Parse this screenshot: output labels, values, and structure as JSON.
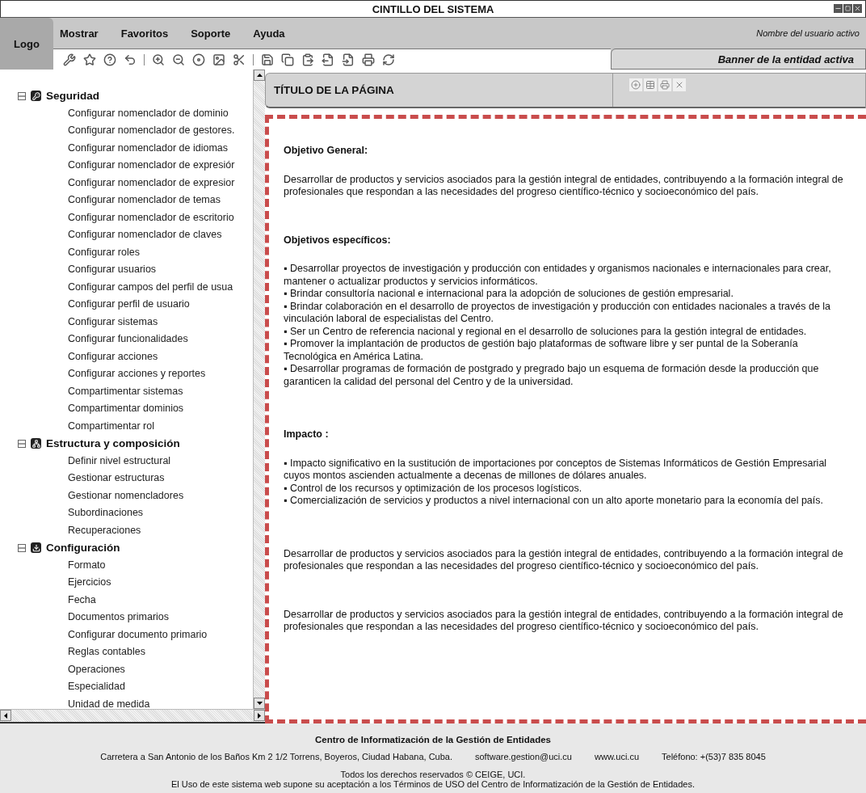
{
  "window": {
    "title": "CINTILLO DEL SISTEMA"
  },
  "header": {
    "logo": "Logo",
    "menu": [
      "Mostrar",
      "Favoritos",
      "Soporte",
      "Ayuda"
    ],
    "user": "Nombre del usuario activo",
    "banner": "Banner de la entidad activa"
  },
  "sidebar": {
    "sections": [
      {
        "label": "Seguridad",
        "expanded": true,
        "children": [
          "Configurar nomenclador de dominio",
          "Configurar nomenclador de gestores.",
          "Configurar nomenclador de idiomas",
          "Configurar nomenclador de expresiór",
          "Configurar nomenclador de expresior",
          "Configurar nomenclador de temas",
          "Configurar nomenclador de escritorio",
          "Configurar nomenclador de  claves",
          "Configurar roles",
          "Configurar usuarios",
          "Configurar campos del perfil de usua",
          "Configurar perfil de usuario",
          "Configurar sistemas",
          "Configurar funcionalidades",
          "Configurar acciones",
          "Configurar acciones y reportes",
          "Compartimentar sistemas",
          "Compartimentar  dominios",
          "Compartimentar  rol"
        ]
      },
      {
        "label": "Estructura y composición",
        "expanded": true,
        "children": [
          "Definir nivel estructural",
          "Gestionar estructuras",
          "Gestionar nomencladores",
          "Subordinaciones",
          "Recuperaciones"
        ]
      },
      {
        "label": "Configuración",
        "expanded": true,
        "children": [
          "Formato",
          "Ejercicios",
          "Fecha",
          "Documentos primarios",
          "Configurar documento primario",
          "Reglas contables",
          "Operaciones",
          "Especialidad",
          "Unidad de medida"
        ]
      }
    ]
  },
  "page": {
    "title": "TÍTULO DE LA PÁGINA",
    "blocks": [
      {
        "kind": "heading",
        "text": "Objetivo General:"
      },
      {
        "kind": "para",
        "text": "Desarrollar de productos y servicios asociados para la gestión integral de entidades, contribuyendo a la formación integral de profesionales que respondan a las necesidades del progreso científico-técnico y socioeconómico del país."
      },
      {
        "kind": "heading",
        "text": "Objetivos específicos:"
      },
      {
        "kind": "bullets",
        "items": [
          "▪ Desarrollar proyectos de investigación y producción con entidades y organismos nacionales e internacionales para crear, mantener o actualizar productos y servicios informáticos.",
          "▪ Brindar consultoría nacional e internacional para la adopción de soluciones de gestión empresarial.",
          "▪ Brindar colaboración en el desarrollo de proyectos de investigación y producción con entidades nacionales a través de la vinculación laboral de especialistas del Centro.",
          "▪ Ser un Centro de referencia nacional y regional en el desarrollo de soluciones para la gestión integral de entidades.",
          "▪ Promover la implantación de productos de gestión bajo plataformas de software libre y ser puntal de la Soberanía Tecnológica en América Latina.",
          "▪ Desarrollar programas de formación de postgrado y pregrado bajo un esquema de formación desde la producción que garanticen la calidad del personal del Centro y de la universidad."
        ]
      },
      {
        "kind": "heading",
        "text": "Impacto :"
      },
      {
        "kind": "bullets",
        "items": [
          "▪ Impacto significativo en la sustitución de importaciones por conceptos de Sistemas Informáticos de Gestión Empresarial cuyos montos ascienden actualmente a decenas de millones de dólares anuales.",
          "▪ Control de los recursos y optimización de los procesos logísticos.",
          "▪ Comercialización de servicios y productos a nivel internacional con un alto aporte monetario para la economía del país."
        ]
      },
      {
        "kind": "para",
        "text": "Desarrollar de productos y servicios asociados para la gestión integral de entidades, contribuyendo a la formación integral de profesionales que respondan a las necesidades del progreso científico-técnico y socioeconómico del país."
      },
      {
        "kind": "para",
        "text": "Desarrollar de productos y servicios asociados para la gestión integral de entidades, contribuyendo a la formación integral de profesionales que respondan a las necesidades del progreso científico-técnico y socioeconómico del país."
      }
    ]
  },
  "footer": {
    "org": "Centro de Informatización de la Gestión de Entidades",
    "address": "Carretera a San Antonio de los Baños Km 2 1/2 Torrens, Boyeros, Ciudad Habana, Cuba.",
    "email": "software.gestion@uci.cu",
    "web": "www.uci.cu",
    "phone": "Teléfono: +(53)7 835 8045",
    "rights": "Todos los derechos reservados © CEIGE, UCI.",
    "terms": "El Uso de este sistema web supone su aceptación a los Términos de USO del Centro de Informatización de la Gestión de Entidades."
  }
}
